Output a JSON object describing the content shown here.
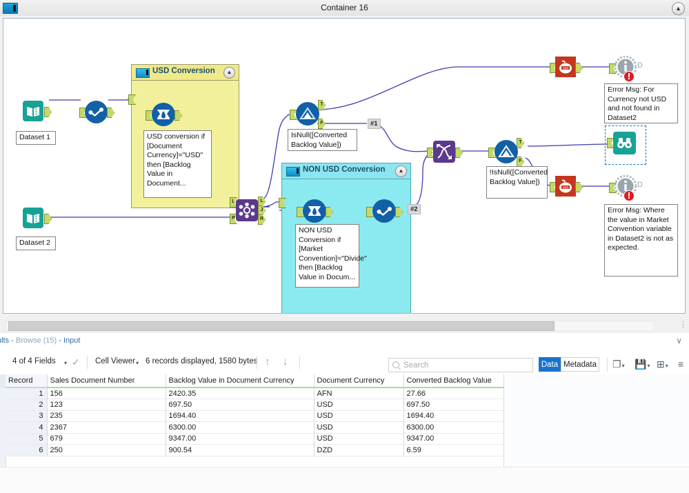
{
  "window": {
    "title": "Container 16",
    "icon": "container-icon",
    "collapse_glyph": "▲"
  },
  "canvas": {
    "containers": [
      {
        "id": "usd",
        "title": "USD Conversion",
        "color": "#f2f09a",
        "collapse_glyph": "▲"
      },
      {
        "id": "nonusd",
        "title": "NON USD Conversion",
        "color": "#8aeaf0",
        "collapse_glyph": "▲"
      }
    ],
    "nodes": [
      {
        "id": "dataset1",
        "label": "Dataset 1",
        "icon": "input-data-icon",
        "color": "#16a396"
      },
      {
        "id": "dataset2",
        "label": "Dataset 2",
        "icon": "input-data-icon",
        "color": "#16a396"
      },
      {
        "id": "select1",
        "label": "",
        "icon": "select-tool-icon",
        "color": "#1160a8"
      },
      {
        "id": "formula-usd",
        "label": "",
        "icon": "formula-tool-icon",
        "color": "#1160a8"
      },
      {
        "id": "join",
        "label": "",
        "icon": "join-tool-icon",
        "color": "#5b3a8e"
      },
      {
        "id": "formula-nonusd",
        "label": "",
        "icon": "formula-tool-icon",
        "color": "#1160a8"
      },
      {
        "id": "select-nonusd",
        "label": "",
        "icon": "select-tool-icon",
        "color": "#1160a8"
      },
      {
        "id": "filter1",
        "label": "IsNull([Converted Backlog Value])",
        "icon": "filter-tool-icon",
        "color": "#1160a8"
      },
      {
        "id": "union",
        "label": "",
        "icon": "union-tool-icon",
        "color": "#5b3a8e"
      },
      {
        "id": "filter2",
        "label": "!IsNull([Converted Backlog Value])",
        "icon": "filter-tool-icon",
        "color": "#1160a8"
      },
      {
        "id": "count-top",
        "label": "",
        "icon": "count-records-icon",
        "color": "#c4361f"
      },
      {
        "id": "count-bottom",
        "label": "",
        "icon": "count-records-icon",
        "color": "#c4361f"
      },
      {
        "id": "message-top",
        "label": "D",
        "icon": "message-tool-icon",
        "color": "#9aa6ae"
      },
      {
        "id": "message-bottom",
        "label": "D",
        "icon": "message-tool-icon",
        "color": "#9aa6ae"
      },
      {
        "id": "browse",
        "label": "",
        "icon": "browse-tool-icon",
        "color": "#16a396"
      }
    ],
    "annotations": {
      "usd_formula": "USD conversion if [Document Currency]=\"USD\" then [Backlog Value in Document...",
      "nonusd_formula": "NON USD Conversion if [Market Convention]=\"Divide\" then [Backlog Value in Docum...",
      "filter1_expr": "IsNull([Converted Backlog Value])",
      "filter2_expr": "!IsNull([Converted Backlog Value])",
      "error_msg_top": "Error Msg: For Currency not USD and not found in Dataset2",
      "error_msg_bottom": "Error Msg: Where the value in Market Convention variable in Dataset2 is not as expected."
    },
    "connection_labels": [
      "#1",
      "#2"
    ],
    "port_labels": {
      "true": "T",
      "false": "F",
      "left": "L",
      "join": "J",
      "right": "R"
    }
  },
  "results": {
    "breadcrumb_prefix": "ults - ",
    "breadcrumb_tool": "Browse (15)",
    "breadcrumb_suffix": " - Input",
    "collapse_glyph": "∨",
    "toolbar": {
      "fields_label": "4 of 4 Fields",
      "fields_caret": "▾",
      "check_glyph": "✓",
      "viewer_label": "Cell Viewer",
      "viewer_caret": "▾",
      "records_label": "6 records displayed, 1580 bytes",
      "up_arrow": "↑",
      "down_arrow": "↓"
    },
    "search": {
      "value": "",
      "placeholder": "Search",
      "icon": "search-icon"
    },
    "tabs": [
      {
        "label": "Data",
        "active": true
      },
      {
        "label": "Metadata",
        "active": false
      }
    ],
    "icon_buttons": [
      {
        "name": "copy-icon",
        "glyph": "❐",
        "caret": "▾"
      },
      {
        "name": "save-icon",
        "glyph": "💾",
        "caret": "▾"
      },
      {
        "name": "add-icon",
        "glyph": "⊞",
        "caret": "▾"
      },
      {
        "name": "menu-icon",
        "glyph": "≡",
        "caret": ""
      }
    ],
    "table": {
      "columns": [
        "Record",
        "Sales Document Number",
        "Backlog Value in Document Currency",
        "Document Currency",
        "Converted Backlog Value"
      ],
      "rows": [
        [
          "1",
          "156",
          "2420.35",
          "AFN",
          "27.66"
        ],
        [
          "2",
          "123",
          "697.50",
          "USD",
          "697.50"
        ],
        [
          "3",
          "235",
          "1694.40",
          "USD",
          "1694.40"
        ],
        [
          "4",
          "2367",
          "6300.00",
          "USD",
          "6300.00"
        ],
        [
          "5",
          "679",
          "9347.00",
          "USD",
          "9347.00"
        ],
        [
          "6",
          "250",
          "900.54",
          "DZD",
          "6.59"
        ]
      ]
    }
  },
  "colors": {
    "accent": "#1a73cb",
    "tool_blue": "#1160a8",
    "tool_purple": "#5b3a8e",
    "tool_teal": "#16a396",
    "tool_red": "#c4361f",
    "container_yellow": "#f2f09a",
    "container_cyan": "#8aeaf0",
    "wire": "#3b3bb0"
  }
}
